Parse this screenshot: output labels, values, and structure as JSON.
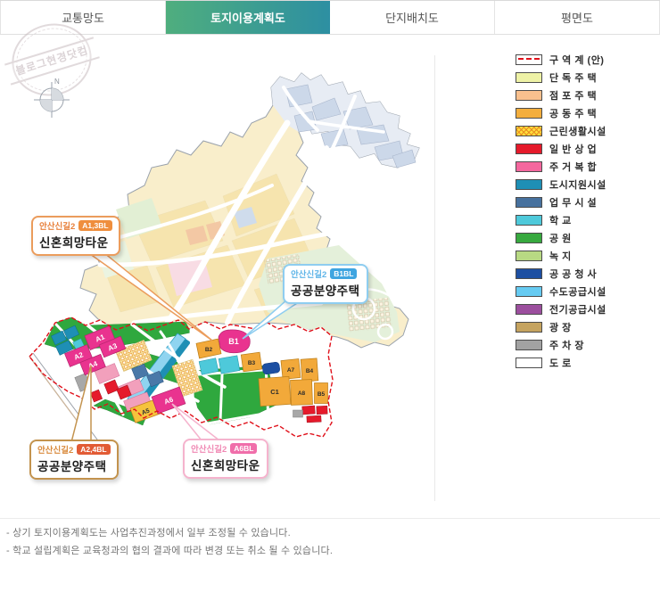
{
  "tabs": [
    {
      "label": "교통망도",
      "active": false
    },
    {
      "label": "토지이용계획도",
      "active": true
    },
    {
      "label": "단지배치도",
      "active": false
    },
    {
      "label": "평면도",
      "active": false
    }
  ],
  "stamp": {
    "text": "블로그현경닷컴"
  },
  "compass": {
    "label": "N"
  },
  "theme": {
    "active_tab_gradient": [
      "#4fae7e",
      "#2d8fa2"
    ],
    "boundary_red": "#e0101a"
  },
  "legend": {
    "items": [
      {
        "label": "구 역 계 (안)",
        "color": "#ffffff",
        "pattern": "boundary",
        "line_color": "#e0101a"
      },
      {
        "label": "단 독 주 택",
        "color": "#eef2a6"
      },
      {
        "label": "점 포 주 택",
        "color": "#f9c08e"
      },
      {
        "label": "공 동 주 택",
        "color": "#f3ae3d"
      },
      {
        "label": "근린생활시설",
        "color": "#ffdf3d",
        "pattern": "hatch",
        "hatch_color": "#e8891f"
      },
      {
        "label": "일 반 상 업",
        "color": "#e51a2b"
      },
      {
        "label": "주 거 복 합",
        "color": "#f4679e"
      },
      {
        "label": "도시지원시설",
        "color": "#1e8fb5"
      },
      {
        "label": "업 무 시 설",
        "color": "#47719e"
      },
      {
        "label": "학 교",
        "color": "#4ec9da"
      },
      {
        "label": "공 원",
        "color": "#37a93f"
      },
      {
        "label": "녹 지",
        "color": "#b8d983"
      },
      {
        "label": "공 공 청 사",
        "color": "#1d4fa2"
      },
      {
        "label": "수도공급시설",
        "color": "#66cbf2"
      },
      {
        "label": "전기공급시설",
        "color": "#9c4f9e"
      },
      {
        "label": "광 장",
        "color": "#c5a35f"
      },
      {
        "label": "주 차 장",
        "color": "#a2a2a2"
      },
      {
        "label": "도 로",
        "color": "#ffffff"
      }
    ]
  },
  "callouts": [
    {
      "district": "안산신길2",
      "badge": "A1,3BL",
      "title": "신혼희망타운",
      "border": "#eb9c5c",
      "accent": "#e8813c",
      "badge_bg": "#ef8e3d"
    },
    {
      "district": "안산신길2",
      "badge": "B1BL",
      "title": "공공분양주택",
      "border": "#8ecdf0",
      "accent": "#5fb5e8",
      "badge_bg": "#3fa5e0"
    },
    {
      "district": "안산신길2",
      "badge": "A2,4BL",
      "title": "공공분양주택",
      "border": "#c3934e",
      "accent": "#d98a3c",
      "badge_bg": "#e25b35"
    },
    {
      "district": "안산신길2",
      "badge": "A6BL",
      "title": "신혼희망타운",
      "border": "#f5b3cd",
      "accent": "#f089b4",
      "badge_bg": "#f06eaa"
    }
  ],
  "map_labels": {
    "a1": "A1",
    "a2": "A2",
    "a3": "A3",
    "a4": "A4",
    "a5": "A5",
    "a6": "A6",
    "b1": "B1",
    "b2": "B2",
    "b3": "B3",
    "a7": "A7",
    "b4": "B4",
    "c1": "C1",
    "a8": "A8",
    "b5": "B5"
  },
  "footnotes": [
    "- 상기 토지이용계획도는 사업추진과정에서 일부 조정될 수 있습니다.",
    "- 학교 설립계획은 교육청과의 협의 결과에 따라 변경 또는 취소 될 수 있습니다."
  ]
}
